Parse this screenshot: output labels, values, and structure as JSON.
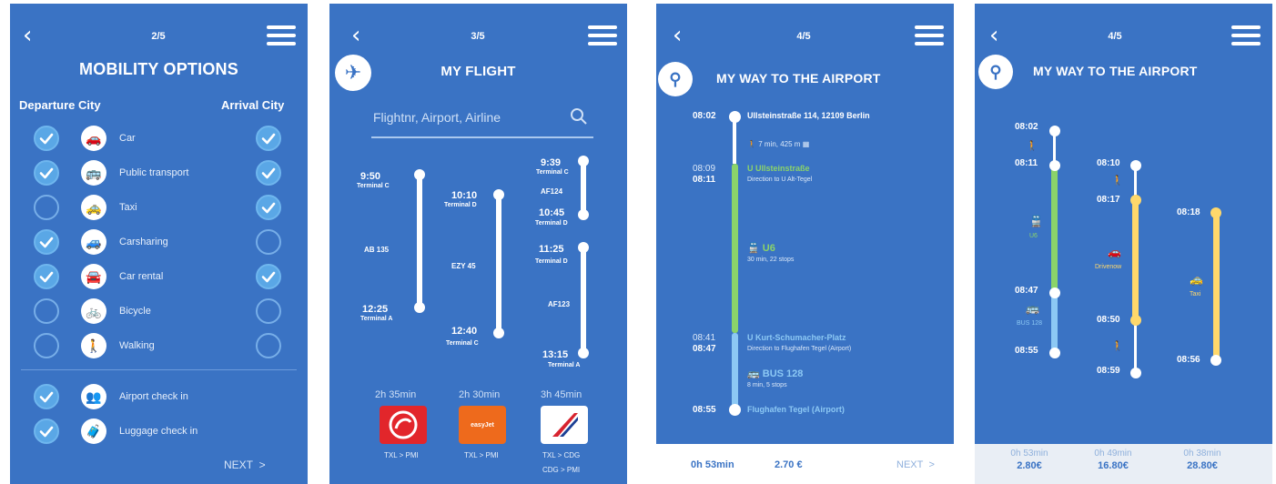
{
  "screen1": {
    "pager": "2/5",
    "title": "MOBILITY OPTIONS",
    "departure_header": "Departure City",
    "arrival_header": "Arrival City",
    "modes": [
      {
        "label": "Car",
        "icon": "car-icon",
        "departure": true,
        "arrival": true
      },
      {
        "label": "Public transport",
        "icon": "bus-icon",
        "departure": true,
        "arrival": true
      },
      {
        "label": "Taxi",
        "icon": "taxi-icon",
        "departure": false,
        "arrival": true
      },
      {
        "label": "Carsharing",
        "icon": "carsharing-icon",
        "departure": true,
        "arrival": false
      },
      {
        "label": "Car rental",
        "icon": "car-rental-icon",
        "departure": true,
        "arrival": true
      },
      {
        "label": "Bicycle",
        "icon": "bicycle-icon",
        "departure": false,
        "arrival": false
      },
      {
        "label": "Walking",
        "icon": "walking-icon",
        "departure": false,
        "arrival": false
      }
    ],
    "extras": [
      {
        "label": "Airport check in",
        "icon": "people-icon",
        "checked": true
      },
      {
        "label": "Luggage check in",
        "icon": "luggage-people-icon",
        "checked": true
      }
    ],
    "next": "NEXT"
  },
  "screen2": {
    "pager": "3/5",
    "title": "MY FLIGHT",
    "search_placeholder": "Flightnr, Airport, Airline",
    "flights": [
      {
        "dep_time": "9:50",
        "dep_term": "Terminal C",
        "code": "AB 135",
        "arr_time": "12:25",
        "arr_term": "Terminal A",
        "duration": "2h 35min",
        "route": "TXL > PMI",
        "logo": "airberlin-logo"
      },
      {
        "dep_time": "10:10",
        "dep_term": "Terminal D",
        "code": "EZY 45",
        "arr_time": "12:40",
        "arr_term": "Terminal C",
        "duration": "2h 30min",
        "route": "TXL > PMI",
        "logo": "easyjet-logo"
      },
      {
        "dep_time": "9:39",
        "dep_term": "Terminal C",
        "code": "AF124",
        "mid_arr_time": "10:45",
        "mid_arr_term": "Terminal D",
        "mid_dep_time": "11:25",
        "mid_dep_term": "Terminal D",
        "code2": "AF123",
        "arr_time": "13:15",
        "arr_term": "Terminal A",
        "duration": "3h 45min",
        "route": "TXL > CDG",
        "route2": "CDG > PMI",
        "logo": "airfrance-logo"
      }
    ],
    "easyjet_text": "easyJet"
  },
  "screen3": {
    "pager": "4/5",
    "title": "MY WAY TO THE AIRPORT",
    "start_time": "08:02",
    "start_address": "Ullsteinstraße 114, 12109 Berlin",
    "walk_info": "7 min, 425 m",
    "t1a": "08:09",
    "t1b": "08:11",
    "stop1": "U Ullsteinstraße",
    "stop1_dir": "Direction to U Alt-Tegel",
    "line1": "U6",
    "line1_info": "30 min, 22 stops",
    "t2a": "08:41",
    "t2b": "08:47",
    "stop2": "U Kurt-Schumacher-Platz",
    "stop2_dir": "Direction to Flughafen Tegel (Airport)",
    "line2": "BUS 128",
    "line2_info": "8 min, 5 stops",
    "end_time": "08:55",
    "end_stop": "Flughafen Tegel (Airport)",
    "total_time": "0h 53min",
    "price": "2.70 €",
    "next": "NEXT"
  },
  "screen4": {
    "pager": "4/5",
    "title": "MY WAY TO THE AIRPORT",
    "opt1": {
      "t_start": "08:02",
      "t_u6": "08:11",
      "u6_label": "U6",
      "t_switch": "08:47",
      "bus_label": "BUS 128",
      "t_end": "08:55"
    },
    "opt2": {
      "t_start": "08:10",
      "t_car_start": "08:17",
      "car_label": "Drivenow",
      "t_car_end": "08:50",
      "t_end": "08:59"
    },
    "opt3": {
      "t_start": "08:18",
      "taxi_label": "Taxi",
      "t_end": "08:56"
    },
    "footer": [
      {
        "time": "0h 53min",
        "price": "2.80€"
      },
      {
        "time": "0h 49min",
        "price": "16.80€"
      },
      {
        "time": "0h 38min",
        "price": "28.80€"
      }
    ]
  }
}
